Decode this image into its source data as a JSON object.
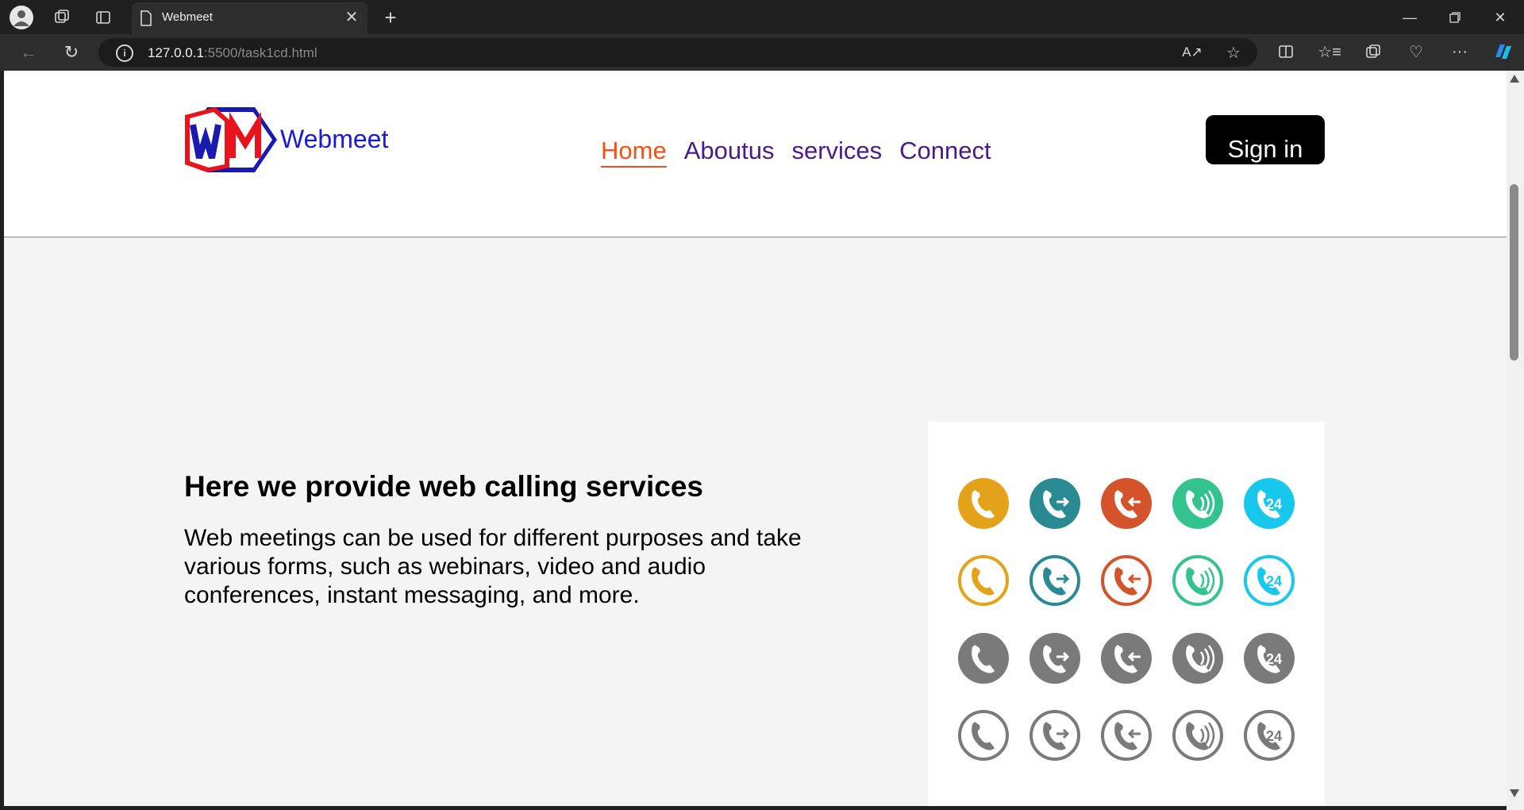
{
  "browser": {
    "tab_title": "Webmeet",
    "url_host": "127.0.0.1",
    "url_rest": ":5500/task1cd.html"
  },
  "header": {
    "logo_text": "WM",
    "brand_name": "Webmeet",
    "nav": [
      {
        "label": "Home",
        "active": true
      },
      {
        "label": "Aboutus",
        "active": false
      },
      {
        "label": "services",
        "active": false
      },
      {
        "label": "Connect",
        "active": false
      }
    ],
    "signin_label": "Sign in"
  },
  "hero": {
    "title": "Here we provide web calling services",
    "description": "Web meetings can be used for different purposes and take various forms, such as webinars, video and audio conferences, instant messaging, and more.",
    "image": {
      "icon_badge_text": "24",
      "row_colors": [
        "#e3a21a",
        "#2a8a94",
        "#d4532b",
        "#34c28f",
        "#18c8ec"
      ],
      "grey_color": "#7a7a7a"
    }
  },
  "colors": {
    "nav_link": "#4b1a8a",
    "nav_active": "#f25016",
    "brand": "#1a1ad6",
    "signin_bg": "#000000"
  }
}
